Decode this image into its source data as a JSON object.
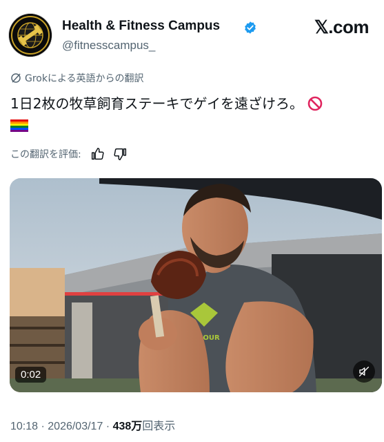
{
  "author": {
    "name": "Health & Fitness Campus",
    "handle": "@fitnesscampus_",
    "verified": true,
    "avatar_icon": "dumbbell-globe-logo"
  },
  "brand": {
    "label": "𝕏.com"
  },
  "translation": {
    "notice": "Grokによる英語からの翻訳",
    "rate_label": "この翻訳を評価:",
    "thumbs_up_icon": "thumbs-up-icon",
    "thumbs_down_icon": "thumbs-down-icon"
  },
  "tweet": {
    "text": "1日2枚の牧草飼育ステーキでゲイを遠ざけろ。",
    "emoji_after_text": "no-entry-sign",
    "emoji_line2": "rainbow-flag"
  },
  "media": {
    "timestamp": "0:02",
    "mute_icon": "muted-speaker-icon",
    "shirt_text": "ARMOUR"
  },
  "meta": {
    "time": "10:18",
    "separator": " · ",
    "date": "2026/03/17",
    "separator2": " · ",
    "views_count": "438万",
    "views_label": "回表示"
  },
  "colors": {
    "verified_blue": "#1d9bf0",
    "secondary_text": "#536471",
    "primary_text": "#0f1419"
  }
}
